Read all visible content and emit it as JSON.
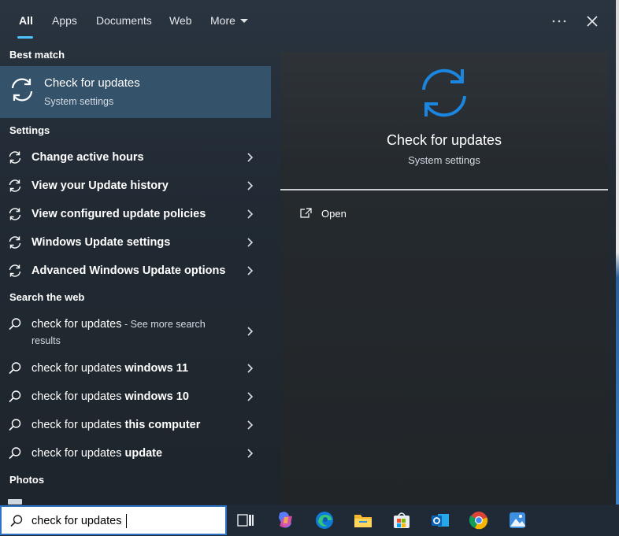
{
  "tabs": [
    {
      "label": "All",
      "active": true
    },
    {
      "label": "Apps"
    },
    {
      "label": "Documents"
    },
    {
      "label": "Web"
    },
    {
      "label": "More"
    }
  ],
  "top_actions": {
    "more_icon": "ellipsis-icon",
    "close_icon": "close-icon"
  },
  "sections": {
    "best_match": "Best match",
    "settings": "Settings",
    "search_web": "Search the web",
    "photos": "Photos"
  },
  "best_match": {
    "title": "Check for updates",
    "subtitle": "System settings",
    "icon": "sync-icon"
  },
  "settings_items": [
    {
      "label": "Change active hours"
    },
    {
      "label": "View your Update history"
    },
    {
      "label": "View configured update policies"
    },
    {
      "label": "Windows Update settings"
    },
    {
      "label": "Advanced Windows Update options"
    }
  ],
  "web_items": [
    {
      "query": "check for updates",
      "suffix": "",
      "see_more": " - See more search results"
    },
    {
      "query": "check for updates ",
      "suffix": "windows 11"
    },
    {
      "query": "check for updates ",
      "suffix": "windows 10"
    },
    {
      "query": "check for updates ",
      "suffix": "this computer"
    },
    {
      "query": "check for updates ",
      "suffix": "update"
    }
  ],
  "preview": {
    "title": "Check for updates",
    "subtitle": "System settings",
    "actions": [
      {
        "label": "Open",
        "icon": "open-external-icon"
      }
    ]
  },
  "search": {
    "value": "check for updates"
  },
  "taskbar_apps": [
    "task-view-icon",
    "copilot-icon",
    "edge-icon",
    "file-explorer-icon",
    "store-icon",
    "outlook-icon",
    "chrome-icon",
    "photos-icon"
  ],
  "colors": {
    "accent": "#4cc2ff",
    "sync_blue": "#1a86e0",
    "selected": "#35526b"
  }
}
